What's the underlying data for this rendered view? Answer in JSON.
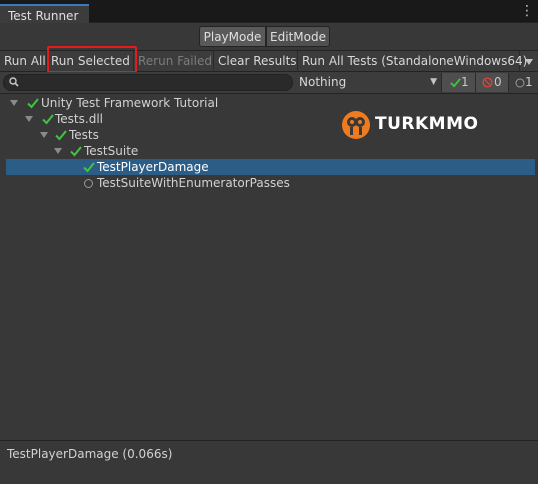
{
  "window": {
    "tab_title": "Test Runner",
    "menu_icon": "kebab-menu-icon"
  },
  "modes": {
    "play": "PlayMode",
    "edit": "EditMode"
  },
  "toolbar": {
    "run_all": "Run All",
    "run_selected": "Run Selected",
    "rerun_failed": "Rerun Failed",
    "clear_results": "Clear Results",
    "run_target": "Run All Tests (StandaloneWindows64)"
  },
  "filter": {
    "search_value": "",
    "search_placeholder": "",
    "category": "Nothing",
    "passed_count": "1",
    "failed_count": "0",
    "skipped_count": "1"
  },
  "tree": {
    "root": "Unity Test Framework Tutorial",
    "assembly": "Tests.dll",
    "namespace": "Tests",
    "fixture": "TestSuite",
    "test1": "TestPlayerDamage",
    "test2": "TestSuiteWithEnumeratorPasses"
  },
  "watermark": {
    "text": "TURKMMO"
  },
  "status": {
    "text": "TestPlayerDamage (0.066s)"
  },
  "colors": {
    "accent": "#3a79bb",
    "pass": "#3ec73e",
    "fail": "#e0453a",
    "selection": "#2c5d87",
    "highlight": "#e31b1b",
    "watermark": "#f07a1e"
  }
}
